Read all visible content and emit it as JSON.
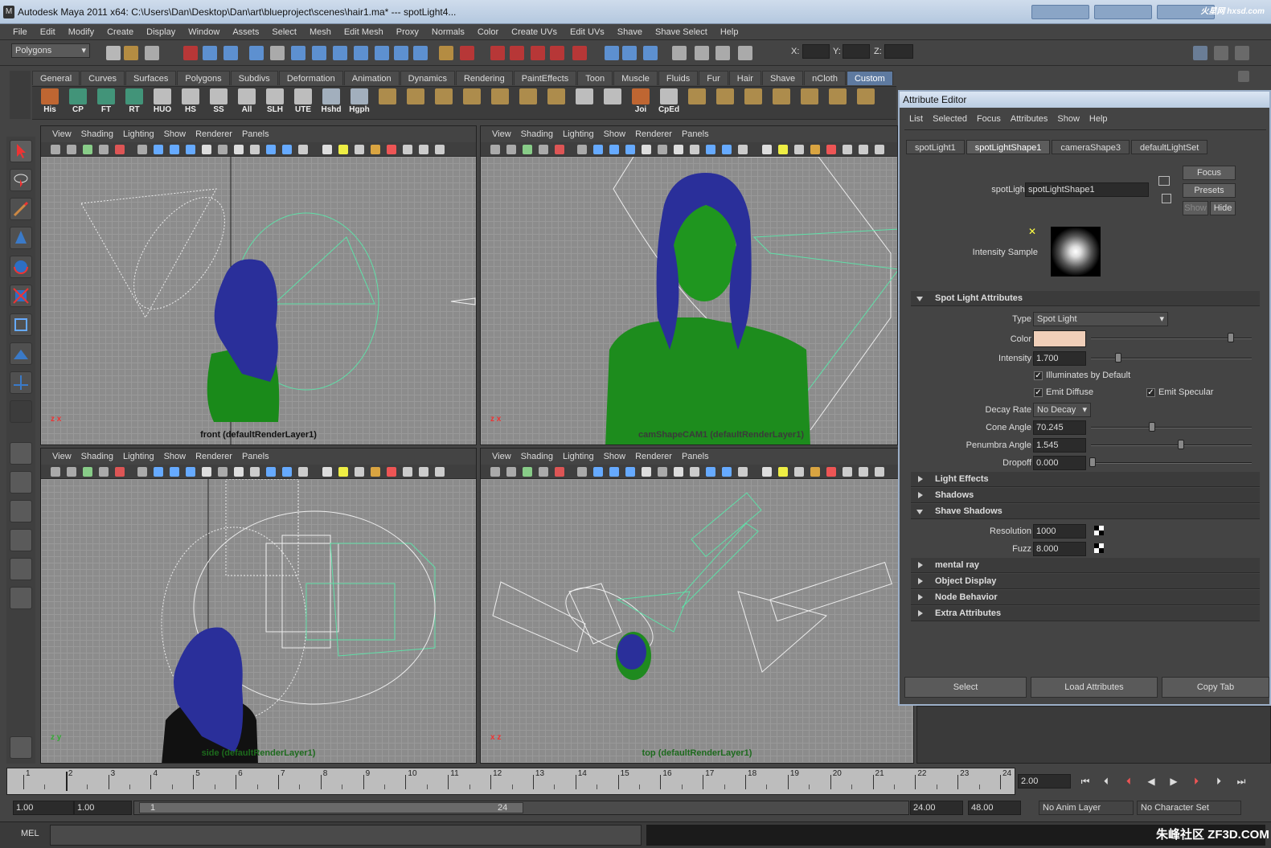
{
  "window": {
    "title": "Autodesk Maya 2011 x64: C:\\Users\\Dan\\Desktop\\Dan\\art\\blueproject\\scenes\\hair1.ma*   ---   spotLight4..."
  },
  "menubar": [
    "File",
    "Edit",
    "Modify",
    "Create",
    "Display",
    "Window",
    "Assets",
    "Select",
    "Mesh",
    "Edit Mesh",
    "Proxy",
    "Normals",
    "Color",
    "Create UVs",
    "Edit UVs",
    "Shave",
    "Shave Select",
    "Help"
  ],
  "status": {
    "menuset": "Polygons",
    "x_label": "X:",
    "y_label": "Y:",
    "z_label": "Z:"
  },
  "shelf_tabs": [
    "General",
    "Curves",
    "Surfaces",
    "Polygons",
    "Subdivs",
    "Deformation",
    "Animation",
    "Dynamics",
    "Rendering",
    "PaintEffects",
    "Toon",
    "Muscle",
    "Fluids",
    "Fur",
    "Hair",
    "Shave",
    "nCloth",
    "Custom"
  ],
  "shelf_active": "Custom",
  "shelf_items": [
    "His",
    "CP",
    "FT",
    "RT",
    "HUO",
    "HS",
    "SS",
    "All",
    "SLH",
    "UTE",
    "Hshd",
    "Hgph",
    "",
    "",
    "",
    "",
    "",
    "",
    "",
    "",
    "",
    "Joi",
    "CpEd"
  ],
  "viewport_menu": [
    "View",
    "Shading",
    "Lighting",
    "Show",
    "Renderer",
    "Panels"
  ],
  "viewports": [
    {
      "label": "front (defaultRenderLayer1)",
      "axes": "z x"
    },
    {
      "label": "camShapeCAM1 (defaultRenderLayer1)",
      "axes": "z x"
    },
    {
      "label": "side (defaultRenderLayer1)",
      "axes": "z y"
    },
    {
      "label": "top (defaultRenderLayer1)",
      "axes": "x z"
    }
  ],
  "attribute_editor": {
    "title": "Attribute Editor",
    "menu": [
      "List",
      "Selected",
      "Focus",
      "Attributes",
      "Show",
      "Help"
    ],
    "tabs": [
      "spotLight1",
      "spotLightShape1",
      "cameraShape3",
      "defaultLightSet"
    ],
    "active_tab": "spotLightShape1",
    "node_label": "spotLight:",
    "node_value": "spotLightShape1",
    "buttons": {
      "focus": "Focus",
      "presets": "Presets",
      "show": "Show",
      "hide": "Hide"
    },
    "intensity_sample_label": "Intensity Sample",
    "sections": {
      "spot": "Spot Light Attributes",
      "light_effects": "Light Effects",
      "shadows": "Shadows",
      "shave_shadows": "Shave Shadows",
      "mental_ray": "mental ray",
      "object_display": "Object Display",
      "node_behavior": "Node Behavior",
      "extra": "Extra Attributes"
    },
    "spot": {
      "type_label": "Type",
      "type_value": "Spot Light",
      "color_label": "Color",
      "color_value": "#f0cfb9",
      "intensity_label": "Intensity",
      "intensity_value": "1.700",
      "illum_label": "Illuminates by Default",
      "diffuse_label": "Emit Diffuse",
      "specular_label": "Emit Specular",
      "decay_label": "Decay Rate",
      "decay_value": "No Decay",
      "cone_label": "Cone Angle",
      "cone_value": "70.245",
      "penumbra_label": "Penumbra Angle",
      "penumbra_value": "1.545",
      "dropoff_label": "Dropoff",
      "dropoff_value": "0.000"
    },
    "shave": {
      "resolution_label": "Resolution",
      "resolution_value": "1000",
      "fuzz_label": "Fuzz",
      "fuzz_value": "8.000"
    },
    "bottom_buttons": [
      "Select",
      "Load Attributes",
      "Copy Tab"
    ]
  },
  "timeline": {
    "ticks": [
      "1",
      "2",
      "3",
      "4",
      "5",
      "6",
      "7",
      "8",
      "9",
      "10",
      "11",
      "12",
      "13",
      "14",
      "15",
      "16",
      "17",
      "18",
      "19",
      "20",
      "21",
      "22",
      "23",
      "24"
    ],
    "current_frame": "2.00",
    "range": {
      "start": "1.00",
      "start2": "1.00",
      "slider_start": "1",
      "slider_end": "24",
      "end": "24.00",
      "end2": "48.00",
      "anim_layer": "No Anim Layer",
      "char_set": "No Character Set"
    }
  },
  "cmdline": {
    "label": "MEL"
  },
  "watermark": {
    "top": "火星网 hxsd.com",
    "bottom": "朱峰社区 ZF3D.COM"
  }
}
